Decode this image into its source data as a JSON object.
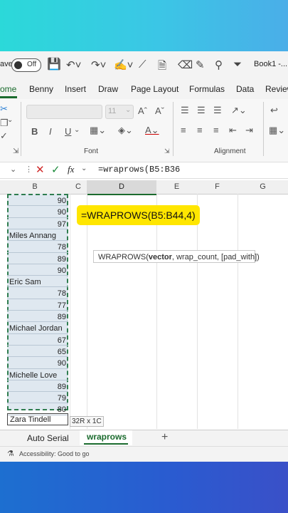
{
  "title_bar": {
    "autosave_label": "ave",
    "toggle_label": "Off",
    "book_title": "Book1 -..."
  },
  "tabs": [
    "ome",
    "Benny",
    "Insert",
    "Draw",
    "Page Layout",
    "Formulas",
    "Data",
    "Review"
  ],
  "ribbon": {
    "font_size": "11",
    "font_group_label": "Font",
    "alignment_group_label": "Alignment",
    "bold": "B",
    "italic": "I",
    "underline": "U"
  },
  "formula_bar": {
    "fx": "fx",
    "content": "=wraprows(B5:B36"
  },
  "columns": {
    "b": "B",
    "c": "C",
    "d": "D",
    "e": "E",
    "f": "F",
    "g": "G"
  },
  "cells_b": [
    "90",
    "90",
    "97",
    "Miles Annang",
    "78",
    "89",
    "90",
    "Eric Sam",
    "78",
    "77",
    "89",
    "Michael Jordan",
    "67",
    "65",
    "90",
    "Michelle Love",
    "89",
    "79",
    "80"
  ],
  "next_cell": "Zara Tindell",
  "selection_tooltip": "32R x 1C",
  "formula_callout": "=WRAPROWS(B5:B44,4)",
  "autocomplete": {
    "func": "WRAPROWS(",
    "arg1": "vector",
    "rest": ", wrap_count, [pad_with])"
  },
  "sheets": {
    "sheet1": "Auto Serial",
    "sheet2": "wraprows",
    "add": "+"
  },
  "status": "Accessibility: Good to go",
  "colors": {
    "accent_green": "#1b6b2e",
    "callout_yellow": "#ffe600"
  }
}
